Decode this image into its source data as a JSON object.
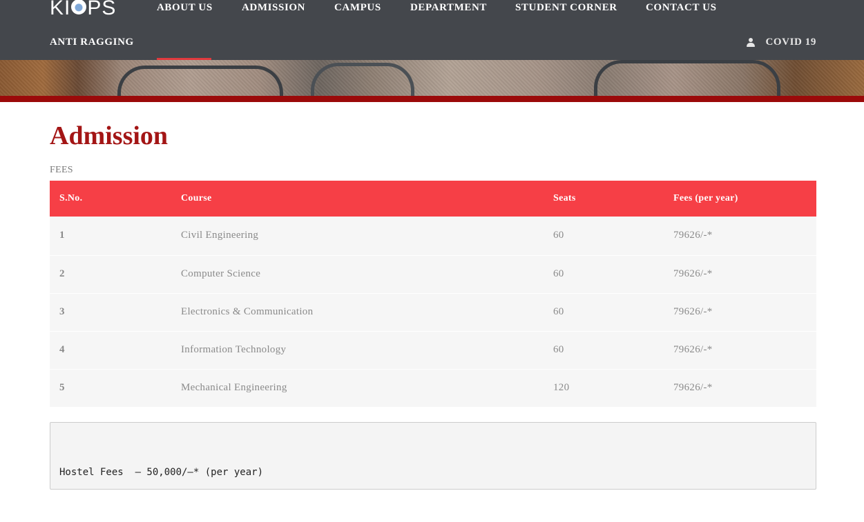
{
  "header": {
    "logo_text_left": "KI",
    "logo_text_right": "PS",
    "nav_row1": [
      "ABOUT US",
      "ADMISSION",
      "CAMPUS",
      "DEPARTMENT",
      "STUDENT CORNER",
      "CONTACT US"
    ],
    "nav_row2": [
      "ANTI RAGGING"
    ],
    "active_item": "ADMISSION",
    "covid_label": "COVID 19",
    "covid_icon": "user-icon"
  },
  "page": {
    "title": "Admission",
    "section_label": "FEES"
  },
  "fees_table": {
    "headers": [
      "S.No.",
      "Course",
      "Seats",
      "Fees (per year)"
    ],
    "rows": [
      [
        "1",
        "Civil Engineering",
        "60",
        "79626/-*"
      ],
      [
        "2",
        "Computer Science",
        "60",
        "79626/-*"
      ],
      [
        "3",
        "Electronics & Communication",
        "60",
        "79626/-*"
      ],
      [
        "4",
        "Information Technology",
        "60",
        "79626/-*"
      ],
      [
        "5",
        "Mechanical Engineering",
        "120",
        "79626/-*"
      ]
    ]
  },
  "hostel": {
    "text": "Hostel Fees  – 50,000/–* (per year)"
  },
  "colors": {
    "header_bg": "#44474c",
    "accent_red": "#a31515",
    "table_header_bg": "#f63f46",
    "active_bar": "#e03a3e"
  }
}
